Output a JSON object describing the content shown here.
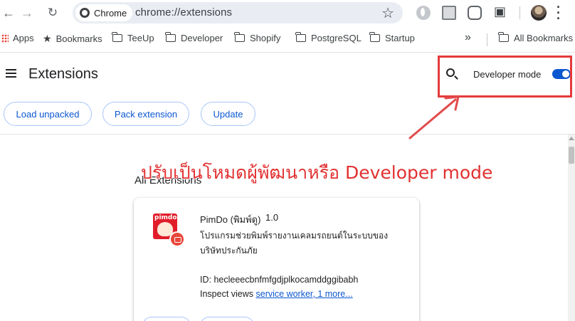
{
  "toolbar": {
    "back_icon": "arrow-left-icon",
    "forward_icon": "arrow-right-icon",
    "reload_icon": "reload-icon",
    "site_chip": "Chrome",
    "url": "chrome://extensions",
    "bookmark_star_icon": "star-outline-icon"
  },
  "bookmarks": {
    "items": [
      {
        "label": "Apps",
        "icon": "apps-grid-icon"
      },
      {
        "label": "Bookmarks",
        "icon": "star-icon"
      },
      {
        "label": "TeeUp",
        "icon": "folder-icon"
      },
      {
        "label": "Developer",
        "icon": "folder-icon"
      },
      {
        "label": "Shopify",
        "icon": "folder-icon"
      },
      {
        "label": "PostgreSQL",
        "icon": "folder-icon"
      },
      {
        "label": "Startup",
        "icon": "folder-icon"
      }
    ],
    "overflow": "»",
    "all_bookmarks": "All Bookmarks"
  },
  "header": {
    "title": "Extensions",
    "developer_mode_label": "Developer mode",
    "developer_mode_on": true
  },
  "actions": {
    "load_unpacked": "Load unpacked",
    "pack_extension": "Pack extension",
    "update": "Update"
  },
  "annotation": {
    "text": "ปรับเป็นโหมดผู้พัฒนาหรือ Developer mode",
    "color": "#e23131"
  },
  "section": {
    "title": "All Extensions"
  },
  "extension": {
    "logo_text": "pimdo",
    "name": "PimDo (พิมพ์ดู)",
    "version": "1.0",
    "description": "โปรแกรมช่วยพิมพ์รายงานเคลมรถยนต์ในระบบของบริษัทประกันภัย",
    "id_label": "ID:",
    "id": "hecleeecbnfmfgdjplkocamddggibabh",
    "inspect_label": "Inspect views",
    "inspect_link": "service worker, 1 more..."
  },
  "colors": {
    "accent": "#0b57d0",
    "annotation_border": "#e53a3a"
  }
}
